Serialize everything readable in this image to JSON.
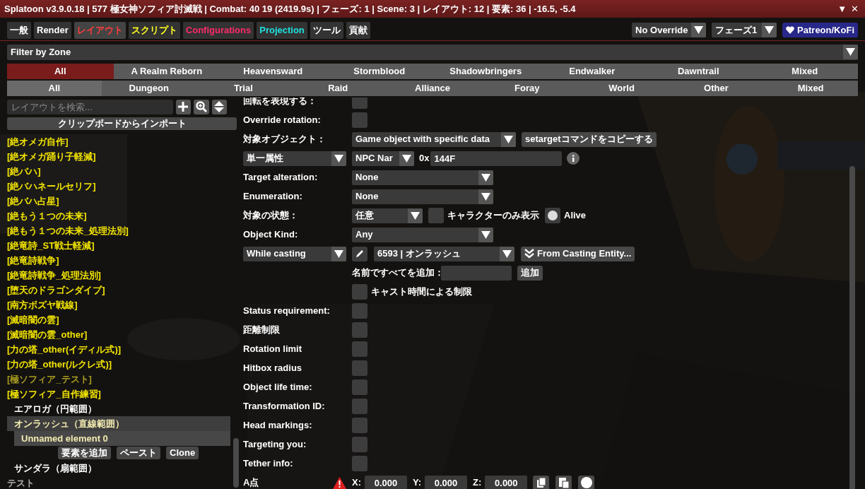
{
  "window": {
    "title": "Splatoon v3.9.0.18 | 577 極女神ソフィア討滅戦 | Combat: 40 19 (2419.9s) | フェーズ: 1 | Scene: 3 | レイアウト: 12 | 要素: 36 | -16.5, -5.4",
    "controls": [
      "▼",
      "✕"
    ]
  },
  "tabs": [
    {
      "label": "一般",
      "color": "#ffffff",
      "selected": false
    },
    {
      "label": "Render",
      "color": "#ffffff",
      "selected": false
    },
    {
      "label": "レイアウト",
      "color": "#ff3b3b",
      "selected": true
    },
    {
      "label": "スクリプト",
      "color": "#ffff20",
      "selected": false
    },
    {
      "label": "Configurations",
      "color": "#ff2a6a",
      "selected": false
    },
    {
      "label": "Projection",
      "color": "#20e0e0",
      "selected": false
    },
    {
      "label": "ツール",
      "color": "#ffffff",
      "selected": false
    },
    {
      "label": "貢献",
      "color": "#ffffff",
      "selected": false
    }
  ],
  "header_dropdowns": [
    {
      "value": "No Override"
    },
    {
      "value": "フェーズ1"
    }
  ],
  "support_button": {
    "label": "Patreon/KoFi"
  },
  "zone_filter": {
    "value": "Filter by Zone"
  },
  "expansions": [
    {
      "label": "All",
      "selected": true
    },
    {
      "label": "A Realm Reborn",
      "selected": false
    },
    {
      "label": "Heavensward",
      "selected": false
    },
    {
      "label": "Stormblood",
      "selected": false
    },
    {
      "label": "Shadowbringers",
      "selected": false
    },
    {
      "label": "Endwalker",
      "selected": false
    },
    {
      "label": "Dawntrail",
      "selected": false
    },
    {
      "label": "Mixed",
      "selected": false
    }
  ],
  "content_types": [
    {
      "label": "All",
      "selected": true
    },
    {
      "label": "Dungeon",
      "selected": false
    },
    {
      "label": "Trial",
      "selected": false
    },
    {
      "label": "Raid",
      "selected": false
    },
    {
      "label": "Alliance",
      "selected": false
    },
    {
      "label": "Foray",
      "selected": false
    },
    {
      "label": "World",
      "selected": false
    },
    {
      "label": "Other",
      "selected": false
    },
    {
      "label": "Mixed",
      "selected": false
    }
  ],
  "sidebar": {
    "search": {
      "placeholder": "レイアウトを検索..."
    },
    "import_button": "クリップボードからインポート",
    "layouts": [
      {
        "kind": "layout",
        "name": "[絶オメガ自作]",
        "disabled": false
      },
      {
        "kind": "layout",
        "name": "[絶オメガ踊り子軽減]",
        "disabled": false
      },
      {
        "kind": "layout",
        "name": "[絶バハ]",
        "disabled": false
      },
      {
        "kind": "layout",
        "name": "[絶バハネールセリフ]",
        "disabled": false
      },
      {
        "kind": "layout",
        "name": "[絶バハ占星]",
        "disabled": false
      },
      {
        "kind": "layout",
        "name": "[絶もう１つの未来]",
        "disabled": false
      },
      {
        "kind": "layout",
        "name": "[絶もう１つの未来_処理法別]",
        "disabled": false
      },
      {
        "kind": "layout",
        "name": "[絶竜詩_ST戦士軽減]",
        "disabled": false
      },
      {
        "kind": "layout",
        "name": "[絶竜詩戦争]",
        "disabled": false
      },
      {
        "kind": "layout",
        "name": "[絶竜詩戦争_処理法別]",
        "disabled": false
      },
      {
        "kind": "layout",
        "name": "[堕天のドラゴンダイブ]",
        "disabled": false
      },
      {
        "kind": "layout",
        "name": "[南方ボズヤ戦線]",
        "disabled": false
      },
      {
        "kind": "layout",
        "name": "[滅暗闇の雲]",
        "disabled": false
      },
      {
        "kind": "layout",
        "name": "[滅暗闇の雲_other]",
        "disabled": false
      },
      {
        "kind": "layout",
        "name": "[力の塔_other(イディル式)]",
        "disabled": false
      },
      {
        "kind": "layout",
        "name": "[力の塔_other(ルクレ式)]",
        "disabled": false
      },
      {
        "kind": "layout",
        "name": "[極ソフィア_テスト]",
        "disabled": true
      },
      {
        "kind": "layout",
        "name": "[極ソフィア_自作練習]",
        "disabled": false,
        "elements": [
          {
            "name": "エアロガ（円範囲）",
            "selected": false
          },
          {
            "name": "オンラッシュ（直線範囲）",
            "selected": true,
            "children": [
              {
                "name": "Unnamed element 0",
                "selected": true
              }
            ],
            "buttons": [
              "要素を追加",
              "ペースト",
              "Clone"
            ]
          },
          {
            "name": "サンダラ（扇範囲）",
            "selected": false
          }
        ]
      },
      {
        "kind": "group",
        "name": "テスト"
      }
    ]
  },
  "editor": {
    "rows": [
      {
        "kind": "checkbox",
        "label": "回転を表現する：",
        "checked": false
      },
      {
        "kind": "checkbox",
        "label": "Override rotation:",
        "checked": false
      },
      {
        "kind": "select",
        "label": "対象オブジェクト：",
        "value": "Game object with specific data",
        "button": "setargetコマンドをコピーする"
      },
      {
        "kind": "attribute",
        "select": "単一属性",
        "field": "NPC Nar",
        "prefix": "0x",
        "value": "144F"
      },
      {
        "kind": "select",
        "label": "Target alteration:",
        "value": "None"
      },
      {
        "kind": "select",
        "label": "Enumeration:",
        "value": "None"
      },
      {
        "kind": "state",
        "label": "対象の状態：",
        "value": "任意",
        "options": [
          {
            "label": "キャラクターのみ表示",
            "checked": false
          },
          {
            "label": "Alive",
            "checked": true
          }
        ]
      },
      {
        "kind": "select",
        "label": "Object Kind:",
        "value": "Any"
      },
      {
        "kind": "casting",
        "select": "While casting",
        "value": "6593 | オンラッシュ",
        "button": "From Casting Entity..."
      },
      {
        "kind": "name_input",
        "label": "名前ですべてを追加：",
        "button": "追加"
      },
      {
        "kind": "check_after",
        "label": "キャスト時間による制限",
        "checked": false
      },
      {
        "kind": "checkbox",
        "label": "Status requirement:",
        "checked": false
      },
      {
        "kind": "checkbox",
        "label": "距離制限",
        "checked": false
      },
      {
        "kind": "checkbox",
        "label": "Rotation limit",
        "checked": false
      },
      {
        "kind": "checkbox",
        "label": "Hitbox radius",
        "checked": false
      },
      {
        "kind": "checkbox",
        "label": "Object life time:",
        "checked": false
      },
      {
        "kind": "checkbox",
        "label": "Transformation ID:",
        "checked": false
      },
      {
        "kind": "checkbox",
        "label": "Head markings:",
        "checked": false
      },
      {
        "kind": "checkbox",
        "label": "Targeting you:",
        "checked": false
      },
      {
        "kind": "checkbox",
        "label": "Tether info:",
        "checked": false
      },
      {
        "kind": "point",
        "label": "A点",
        "coords": [
          {
            "axis": "X:",
            "value": "0.000"
          },
          {
            "axis": "Y:",
            "value": "0.000"
          },
          {
            "axis": "Z:",
            "value": "0.000"
          }
        ]
      }
    ]
  }
}
